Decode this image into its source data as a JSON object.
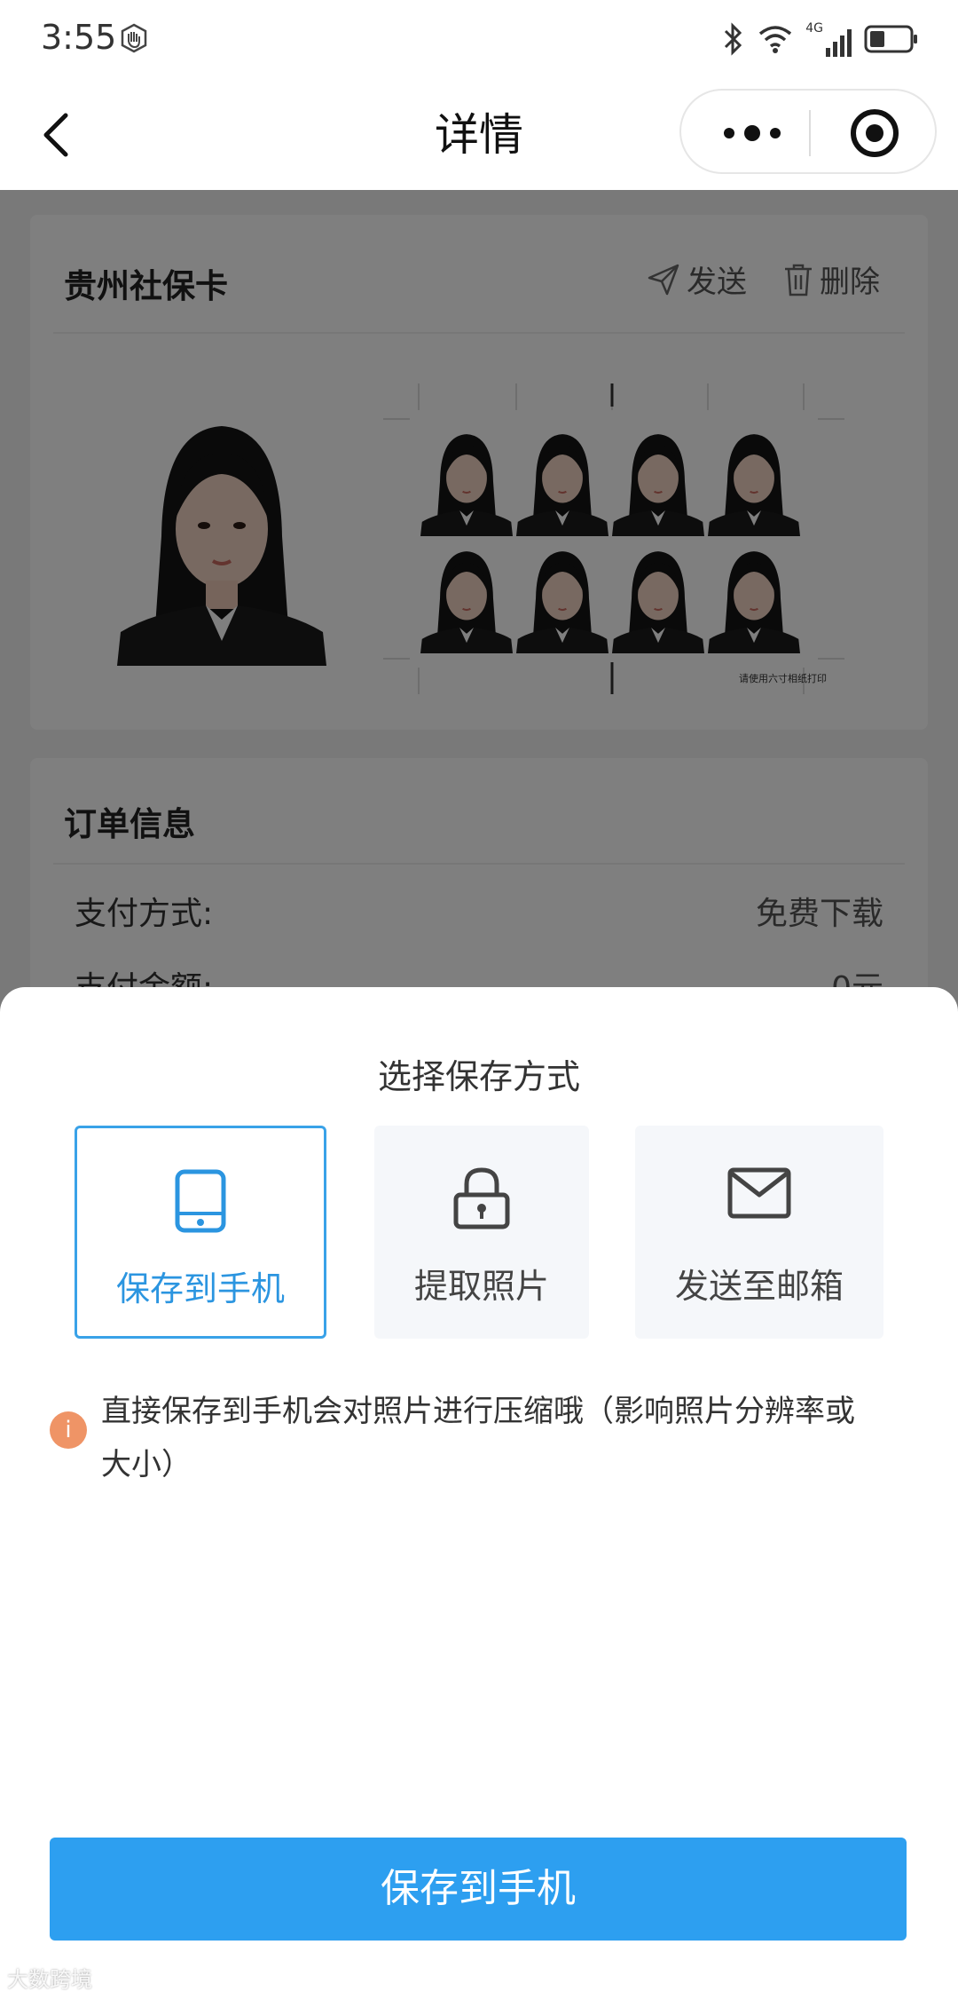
{
  "status_bar": {
    "time": "3:55",
    "network": "4G"
  },
  "nav": {
    "title": "详情"
  },
  "photo_card": {
    "title": "贵州社保卡",
    "send_label": "发送",
    "delete_label": "删除",
    "sheet_caption": "请使用六寸相纸打印"
  },
  "order": {
    "title": "订单信息",
    "rows": [
      {
        "label": "支付方式:",
        "value": "免费下载"
      },
      {
        "label": "支付金额:",
        "value": "0元"
      }
    ]
  },
  "save_panel": {
    "title": "选择保存方式",
    "options": [
      {
        "label": "保存到手机",
        "icon": "phone-icon",
        "selected": true
      },
      {
        "label": "提取照片",
        "icon": "lock-icon",
        "selected": false
      },
      {
        "label": "发送至邮箱",
        "icon": "mail-icon",
        "selected": false
      }
    ],
    "tip_icon": "i",
    "tip": "直接保存到手机会对照片进行压缩哦（影响照片分辨率或大小）",
    "button_label": "保存到手机"
  },
  "watermark": "大数跨境",
  "colors": {
    "accent": "#2d9ff0",
    "selected_border": "#39a2e8",
    "tip": "#ef9466"
  }
}
